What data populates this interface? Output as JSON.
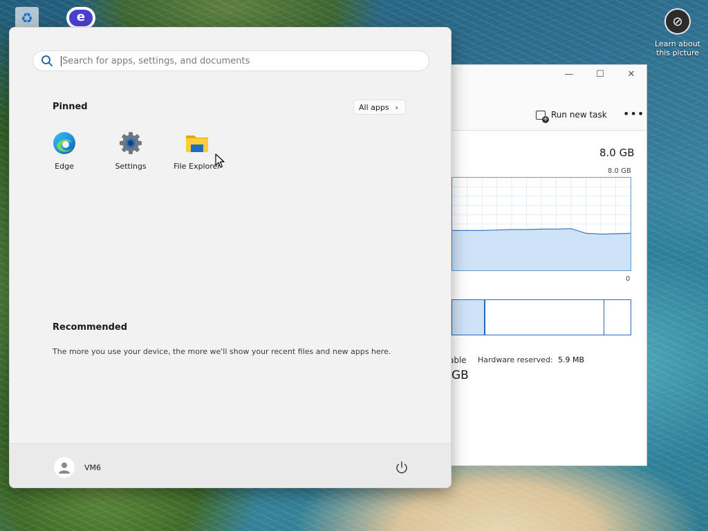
{
  "desktop": {
    "icons": [
      {
        "name": "recycle-bin",
        "icon": "recycle-icon"
      },
      {
        "name": "edge-shortcut",
        "icon": "edge-icon"
      }
    ],
    "learn_widget": {
      "icon": "camera-icon",
      "label": "Learn about this picture"
    }
  },
  "task_manager": {
    "controls": {
      "minimize": "—",
      "maximize": "☐",
      "close": "✕"
    },
    "toolbar": {
      "run_new_task": "Run new task",
      "more": "•••"
    },
    "memory": {
      "total": "8.0 GB",
      "graph_max": "8.0 GB",
      "graph_min": "0",
      "available_fragment": "able",
      "hardware_reserved_label": "Hardware reserved:",
      "hardware_reserved_value": "5.9 MB",
      "gb_fragment": "GB",
      "usage_history": [
        0.43,
        0.43,
        0.43,
        0.435,
        0.44,
        0.44,
        0.445,
        0.445,
        0.45,
        0.4,
        0.39,
        0.395,
        0.4
      ]
    }
  },
  "start_menu": {
    "search": {
      "placeholder": "Search for apps, settings, and documents",
      "value": ""
    },
    "pinned": {
      "title": "Pinned",
      "all_apps_label": "All apps",
      "apps": [
        {
          "label": "Edge",
          "icon": "edge-icon"
        },
        {
          "label": "Settings",
          "icon": "gear-icon"
        },
        {
          "label": "File Explorer",
          "icon": "folder-icon"
        }
      ]
    },
    "recommended": {
      "title": "Recommended",
      "text": "The more you use your device, the more we'll show your recent files and new apps here."
    },
    "user": {
      "name": "VM6",
      "icon": "user-icon"
    },
    "power": {
      "icon": "power-icon"
    }
  },
  "colors": {
    "accent": "#0067c0",
    "graph_line": "#3a78c2",
    "graph_fill": "#cfe3f8"
  }
}
